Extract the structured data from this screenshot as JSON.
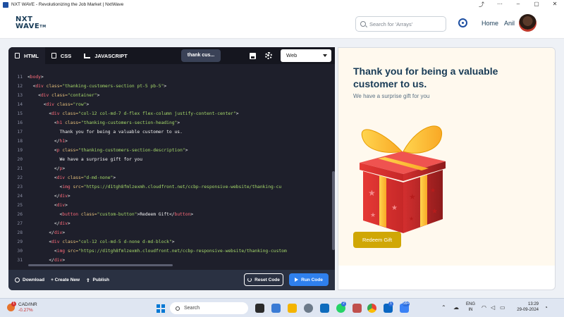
{
  "window": {
    "title": "NXT WAVE - Revolutionizing the Job Market | NxtWave"
  },
  "header": {
    "logo_line1": "NXT",
    "logo_line2": "WAVE",
    "logo_tm": "TM",
    "search_placeholder": "Search for 'Arrays'",
    "home_label": "Home",
    "user_name": "Anil"
  },
  "editor": {
    "tabs": [
      {
        "label": "HTML"
      },
      {
        "label": "CSS"
      },
      {
        "label": "JAVASCRIPT"
      }
    ],
    "file_name": "thank cus...",
    "view_select": "Web",
    "lines": [
      {
        "n": "11",
        "parts": [
          {
            "c": "t-punc",
            "t": "<"
          },
          {
            "c": "t-tag",
            "t": "body"
          },
          {
            "c": "t-punc",
            "t": ">"
          }
        ]
      },
      {
        "n": "12",
        "parts": [
          {
            "c": "t-txt",
            "t": "  "
          },
          {
            "c": "t-punc",
            "t": "<"
          },
          {
            "c": "t-tag",
            "t": "div "
          },
          {
            "c": "t-attr",
            "t": "class="
          },
          {
            "c": "t-str",
            "t": "\"thanking-customers-section pt-5 pb-5\""
          },
          {
            "c": "t-punc",
            "t": ">"
          }
        ]
      },
      {
        "n": "13",
        "parts": [
          {
            "c": "t-txt",
            "t": "    "
          },
          {
            "c": "t-punc",
            "t": "<"
          },
          {
            "c": "t-tag",
            "t": "div "
          },
          {
            "c": "t-attr",
            "t": "class="
          },
          {
            "c": "t-str",
            "t": "\"container\""
          },
          {
            "c": "t-punc",
            "t": ">"
          }
        ]
      },
      {
        "n": "14",
        "parts": [
          {
            "c": "t-txt",
            "t": "      "
          },
          {
            "c": "t-punc",
            "t": "<"
          },
          {
            "c": "t-tag",
            "t": "div "
          },
          {
            "c": "t-attr",
            "t": "class="
          },
          {
            "c": "t-str",
            "t": "\"row\""
          },
          {
            "c": "t-punc",
            "t": ">"
          }
        ]
      },
      {
        "n": "15",
        "parts": [
          {
            "c": "t-txt",
            "t": "        "
          },
          {
            "c": "t-punc",
            "t": "<"
          },
          {
            "c": "t-tag",
            "t": "div "
          },
          {
            "c": "t-attr",
            "t": "class="
          },
          {
            "c": "t-str",
            "t": "\"col-12 col-md-7 d-flex flex-column justify-content-center\""
          },
          {
            "c": "t-punc",
            "t": ">"
          }
        ]
      },
      {
        "n": "16",
        "parts": [
          {
            "c": "t-txt",
            "t": "          "
          },
          {
            "c": "t-punc",
            "t": "<"
          },
          {
            "c": "t-tag",
            "t": "h1 "
          },
          {
            "c": "t-attr",
            "t": "class="
          },
          {
            "c": "t-str",
            "t": "\"thanking-customers-section-heading\""
          },
          {
            "c": "t-punc",
            "t": ">"
          }
        ]
      },
      {
        "n": "17",
        "parts": [
          {
            "c": "t-txt",
            "t": "            Thank you for being a valuable customer to us."
          }
        ]
      },
      {
        "n": "18",
        "parts": [
          {
            "c": "t-txt",
            "t": "          "
          },
          {
            "c": "t-punc",
            "t": "</"
          },
          {
            "c": "t-tag",
            "t": "h1"
          },
          {
            "c": "t-punc",
            "t": ">"
          }
        ]
      },
      {
        "n": "19",
        "parts": [
          {
            "c": "t-txt",
            "t": "          "
          },
          {
            "c": "t-punc",
            "t": "<"
          },
          {
            "c": "t-tag",
            "t": "p "
          },
          {
            "c": "t-attr",
            "t": "class="
          },
          {
            "c": "t-str",
            "t": "\"thanking-customers-section-description\""
          },
          {
            "c": "t-punc",
            "t": ">"
          }
        ]
      },
      {
        "n": "20",
        "parts": [
          {
            "c": "t-txt",
            "t": "            We have a surprise gift for you"
          }
        ]
      },
      {
        "n": "21",
        "parts": [
          {
            "c": "t-txt",
            "t": "          "
          },
          {
            "c": "t-punc",
            "t": "</"
          },
          {
            "c": "t-tag",
            "t": "p"
          },
          {
            "c": "t-punc",
            "t": ">"
          }
        ]
      },
      {
        "n": "22",
        "parts": [
          {
            "c": "t-txt",
            "t": "          "
          },
          {
            "c": "t-punc",
            "t": "<"
          },
          {
            "c": "t-tag",
            "t": "div "
          },
          {
            "c": "t-attr",
            "t": "class="
          },
          {
            "c": "t-str",
            "t": "\"d-md-none\""
          },
          {
            "c": "t-punc",
            "t": ">"
          }
        ]
      },
      {
        "n": "23",
        "parts": [
          {
            "c": "t-txt",
            "t": "            "
          },
          {
            "c": "t-punc",
            "t": "<"
          },
          {
            "c": "t-tag",
            "t": "img "
          },
          {
            "c": "t-attr",
            "t": "src="
          },
          {
            "c": "t-str",
            "t": "\"https://d1tgh8fmlzexmh.cloudfront.net/ccbp-responsive-website/thanking-cu"
          }
        ]
      },
      {
        "n": "24",
        "parts": [
          {
            "c": "t-txt",
            "t": "          "
          },
          {
            "c": "t-punc",
            "t": "</"
          },
          {
            "c": "t-tag",
            "t": "div"
          },
          {
            "c": "t-punc",
            "t": ">"
          }
        ]
      },
      {
        "n": "25",
        "parts": [
          {
            "c": "t-txt",
            "t": "          "
          },
          {
            "c": "t-punc",
            "t": "<"
          },
          {
            "c": "t-tag",
            "t": "div"
          },
          {
            "c": "t-punc",
            "t": ">"
          }
        ]
      },
      {
        "n": "26",
        "parts": [
          {
            "c": "t-txt",
            "t": "            "
          },
          {
            "c": "t-punc",
            "t": "<"
          },
          {
            "c": "t-tag",
            "t": "button "
          },
          {
            "c": "t-attr",
            "t": "class="
          },
          {
            "c": "t-str",
            "t": "\"custom-button\""
          },
          {
            "c": "t-punc",
            "t": ">"
          },
          {
            "c": "t-txt",
            "t": "Redeem Gift"
          },
          {
            "c": "t-punc",
            "t": "</"
          },
          {
            "c": "t-tag",
            "t": "button"
          },
          {
            "c": "t-punc",
            "t": ">"
          }
        ]
      },
      {
        "n": "27",
        "parts": [
          {
            "c": "t-txt",
            "t": "          "
          },
          {
            "c": "t-punc",
            "t": "</"
          },
          {
            "c": "t-tag",
            "t": "div"
          },
          {
            "c": "t-punc",
            "t": ">"
          }
        ]
      },
      {
        "n": "28",
        "parts": [
          {
            "c": "t-txt",
            "t": "        "
          },
          {
            "c": "t-punc",
            "t": "</"
          },
          {
            "c": "t-tag",
            "t": "div"
          },
          {
            "c": "t-punc",
            "t": ">"
          }
        ]
      },
      {
        "n": "29",
        "parts": [
          {
            "c": "t-txt",
            "t": "        "
          },
          {
            "c": "t-punc",
            "t": "<"
          },
          {
            "c": "t-tag",
            "t": "div "
          },
          {
            "c": "t-attr",
            "t": "class="
          },
          {
            "c": "t-str",
            "t": "\"col-12 col-md-5 d-none d-md-block\""
          },
          {
            "c": "t-punc",
            "t": ">"
          }
        ]
      },
      {
        "n": "30",
        "parts": [
          {
            "c": "t-txt",
            "t": "          "
          },
          {
            "c": "t-punc",
            "t": "<"
          },
          {
            "c": "t-tag",
            "t": "img "
          },
          {
            "c": "t-attr",
            "t": "src="
          },
          {
            "c": "t-str",
            "t": "\"https://d1tgh8fmlzexmh.cloudfront.net/ccbp-responsive-website/thanking-custom"
          }
        ]
      },
      {
        "n": "31",
        "parts": [
          {
            "c": "t-txt",
            "t": "        "
          },
          {
            "c": "t-punc",
            "t": "</"
          },
          {
            "c": "t-tag",
            "t": "div"
          },
          {
            "c": "t-punc",
            "t": ">"
          }
        ]
      }
    ],
    "footer": {
      "download": "Download",
      "create_new": "+ Create New",
      "publish": "Publish",
      "reset": "Reset Code",
      "run": "Run Code"
    }
  },
  "preview": {
    "heading": "Thank you for being a valuable customer to us.",
    "description": "We have a surprise gift for you",
    "button": "Redeem Gift"
  },
  "taskbar": {
    "ticker_name": "CAD/INR",
    "ticker_change": "-0.27%",
    "weather_badge": "1",
    "search_label": "Search",
    "whatsapp_badge": "2",
    "linkedin_badge": "1",
    "mail_badge": "99+",
    "lang_line1": "ENG",
    "lang_line2": "IN",
    "time": "13:29",
    "date": "29-09-2024"
  },
  "colors": {
    "brand_dark": "#183b56",
    "editor_bg": "#1e1f2b",
    "run_button": "#2f80ed",
    "redeem_button": "#d0a705",
    "preview_bg": "#fff9ee"
  }
}
